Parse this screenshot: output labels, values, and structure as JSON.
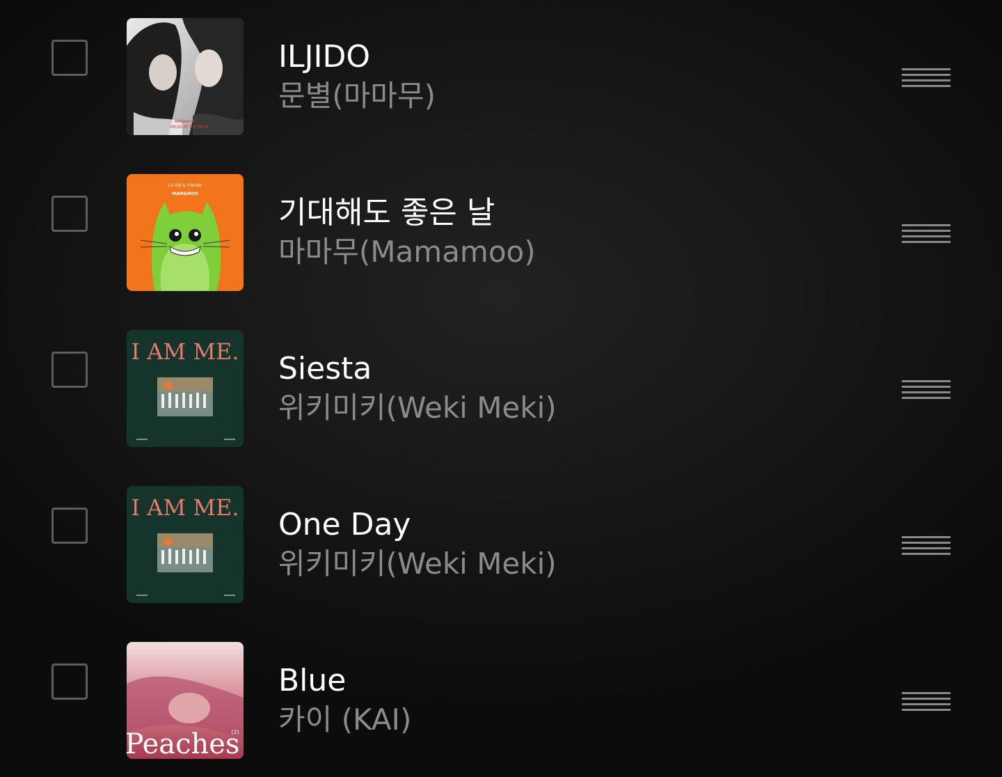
{
  "tracks": [
    {
      "title": "ILJIDO",
      "artist": "문별(마마무)",
      "cover_caption": "6equence",
      "cover_subcaption": "PIECES OF THE MOON"
    },
    {
      "title": "기대해도 좋은 날",
      "artist": "마마무(Mamamoo)",
      "cover_caption": "LG G8 & Friends",
      "cover_subcaption": "MAMAMOO"
    },
    {
      "title": "Siesta",
      "artist": "위키미키(Weki Meki)",
      "cover_caption": "I AM ME."
    },
    {
      "title": "One Day",
      "artist": "위키미키(Weki Meki)",
      "cover_caption": "I AM ME."
    },
    {
      "title": "Blue",
      "artist": "카이 (KAI)",
      "cover_caption": "Peaches",
      "cover_subcaption": "(2)"
    }
  ]
}
